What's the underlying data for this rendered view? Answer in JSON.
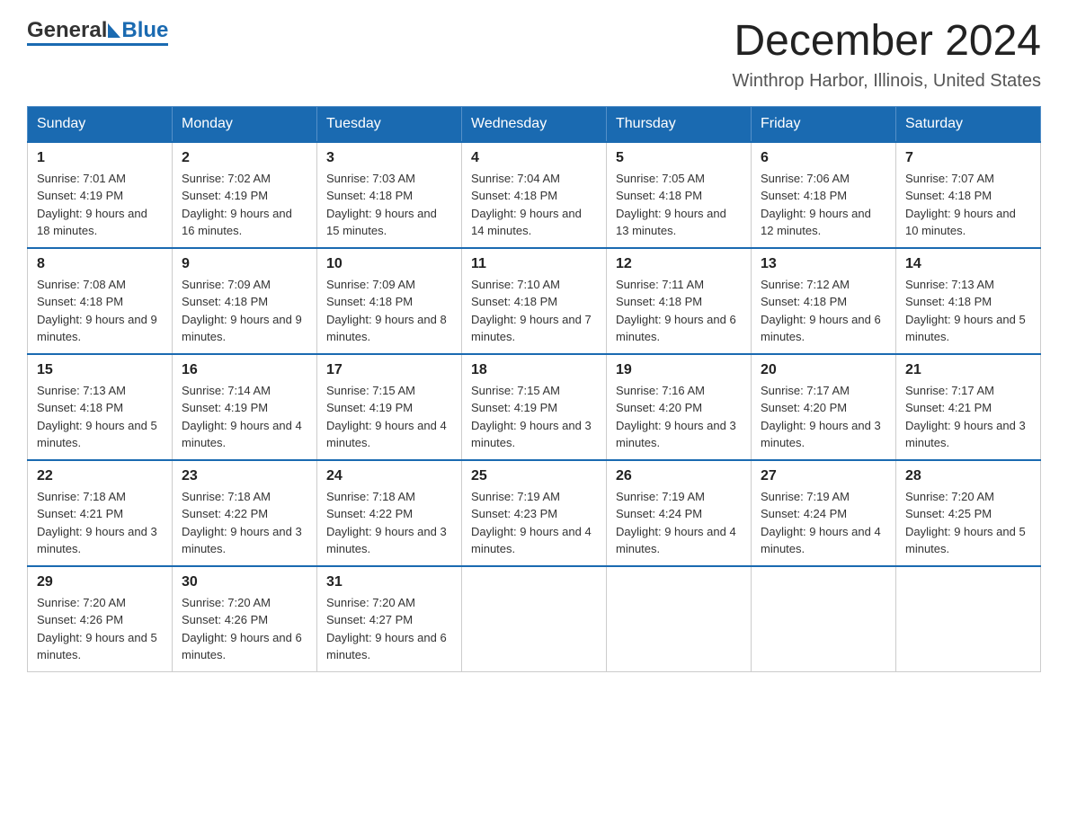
{
  "header": {
    "logo_general": "General",
    "logo_blue": "Blue",
    "title": "December 2024",
    "subtitle": "Winthrop Harbor, Illinois, United States"
  },
  "calendar": {
    "days": [
      "Sunday",
      "Monday",
      "Tuesday",
      "Wednesday",
      "Thursday",
      "Friday",
      "Saturday"
    ],
    "weeks": [
      [
        {
          "date": "1",
          "sunrise": "7:01 AM",
          "sunset": "4:19 PM",
          "daylight": "9 hours and 18 minutes."
        },
        {
          "date": "2",
          "sunrise": "7:02 AM",
          "sunset": "4:19 PM",
          "daylight": "9 hours and 16 minutes."
        },
        {
          "date": "3",
          "sunrise": "7:03 AM",
          "sunset": "4:18 PM",
          "daylight": "9 hours and 15 minutes."
        },
        {
          "date": "4",
          "sunrise": "7:04 AM",
          "sunset": "4:18 PM",
          "daylight": "9 hours and 14 minutes."
        },
        {
          "date": "5",
          "sunrise": "7:05 AM",
          "sunset": "4:18 PM",
          "daylight": "9 hours and 13 minutes."
        },
        {
          "date": "6",
          "sunrise": "7:06 AM",
          "sunset": "4:18 PM",
          "daylight": "9 hours and 12 minutes."
        },
        {
          "date": "7",
          "sunrise": "7:07 AM",
          "sunset": "4:18 PM",
          "daylight": "9 hours and 10 minutes."
        }
      ],
      [
        {
          "date": "8",
          "sunrise": "7:08 AM",
          "sunset": "4:18 PM",
          "daylight": "9 hours and 9 minutes."
        },
        {
          "date": "9",
          "sunrise": "7:09 AM",
          "sunset": "4:18 PM",
          "daylight": "9 hours and 9 minutes."
        },
        {
          "date": "10",
          "sunrise": "7:09 AM",
          "sunset": "4:18 PM",
          "daylight": "9 hours and 8 minutes."
        },
        {
          "date": "11",
          "sunrise": "7:10 AM",
          "sunset": "4:18 PM",
          "daylight": "9 hours and 7 minutes."
        },
        {
          "date": "12",
          "sunrise": "7:11 AM",
          "sunset": "4:18 PM",
          "daylight": "9 hours and 6 minutes."
        },
        {
          "date": "13",
          "sunrise": "7:12 AM",
          "sunset": "4:18 PM",
          "daylight": "9 hours and 6 minutes."
        },
        {
          "date": "14",
          "sunrise": "7:13 AM",
          "sunset": "4:18 PM",
          "daylight": "9 hours and 5 minutes."
        }
      ],
      [
        {
          "date": "15",
          "sunrise": "7:13 AM",
          "sunset": "4:18 PM",
          "daylight": "9 hours and 5 minutes."
        },
        {
          "date": "16",
          "sunrise": "7:14 AM",
          "sunset": "4:19 PM",
          "daylight": "9 hours and 4 minutes."
        },
        {
          "date": "17",
          "sunrise": "7:15 AM",
          "sunset": "4:19 PM",
          "daylight": "9 hours and 4 minutes."
        },
        {
          "date": "18",
          "sunrise": "7:15 AM",
          "sunset": "4:19 PM",
          "daylight": "9 hours and 3 minutes."
        },
        {
          "date": "19",
          "sunrise": "7:16 AM",
          "sunset": "4:20 PM",
          "daylight": "9 hours and 3 minutes."
        },
        {
          "date": "20",
          "sunrise": "7:17 AM",
          "sunset": "4:20 PM",
          "daylight": "9 hours and 3 minutes."
        },
        {
          "date": "21",
          "sunrise": "7:17 AM",
          "sunset": "4:21 PM",
          "daylight": "9 hours and 3 minutes."
        }
      ],
      [
        {
          "date": "22",
          "sunrise": "7:18 AM",
          "sunset": "4:21 PM",
          "daylight": "9 hours and 3 minutes."
        },
        {
          "date": "23",
          "sunrise": "7:18 AM",
          "sunset": "4:22 PM",
          "daylight": "9 hours and 3 minutes."
        },
        {
          "date": "24",
          "sunrise": "7:18 AM",
          "sunset": "4:22 PM",
          "daylight": "9 hours and 3 minutes."
        },
        {
          "date": "25",
          "sunrise": "7:19 AM",
          "sunset": "4:23 PM",
          "daylight": "9 hours and 4 minutes."
        },
        {
          "date": "26",
          "sunrise": "7:19 AM",
          "sunset": "4:24 PM",
          "daylight": "9 hours and 4 minutes."
        },
        {
          "date": "27",
          "sunrise": "7:19 AM",
          "sunset": "4:24 PM",
          "daylight": "9 hours and 4 minutes."
        },
        {
          "date": "28",
          "sunrise": "7:20 AM",
          "sunset": "4:25 PM",
          "daylight": "9 hours and 5 minutes."
        }
      ],
      [
        {
          "date": "29",
          "sunrise": "7:20 AM",
          "sunset": "4:26 PM",
          "daylight": "9 hours and 5 minutes."
        },
        {
          "date": "30",
          "sunrise": "7:20 AM",
          "sunset": "4:26 PM",
          "daylight": "9 hours and 6 minutes."
        },
        {
          "date": "31",
          "sunrise": "7:20 AM",
          "sunset": "4:27 PM",
          "daylight": "9 hours and 6 minutes."
        },
        null,
        null,
        null,
        null
      ]
    ]
  }
}
